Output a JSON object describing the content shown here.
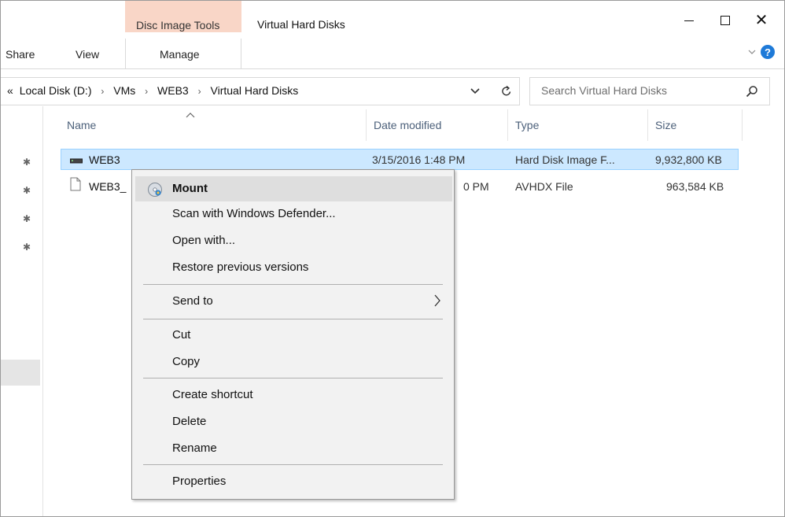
{
  "titlebar": {
    "contextual_tab": "Disc Image Tools",
    "title": "Virtual Hard Disks",
    "close_glyph": "✕"
  },
  "ribbon": {
    "tabs": [
      "Share",
      "View",
      "Manage"
    ],
    "help_glyph": "?"
  },
  "address": {
    "overflow_glyph": "«",
    "crumbs": [
      "Local Disk (D:)",
      "VMs",
      "WEB3",
      "Virtual Hard Disks"
    ],
    "separator": "›"
  },
  "search": {
    "placeholder": "Search Virtual Hard Disks"
  },
  "columns": [
    "Name",
    "Date modified",
    "Type",
    "Size"
  ],
  "files": [
    {
      "name": "WEB3",
      "date": "3/15/2016 1:48 PM",
      "type": "Hard Disk Image F...",
      "size": "9,932,800 KB",
      "selected": true,
      "icon": "disk-image-icon"
    },
    {
      "name": "WEB3_",
      "date": "0 PM",
      "type": "AVHDX File",
      "size": "963,584 KB",
      "selected": false,
      "icon": "file-icon"
    }
  ],
  "context_menu": {
    "items": [
      "Mount",
      "Scan with Windows Defender...",
      "Open with...",
      "Restore previous versions",
      "Send to",
      "Cut",
      "Copy",
      "Create shortcut",
      "Delete",
      "Rename",
      "Properties"
    ],
    "submenu_glyph": ">"
  },
  "colors": {
    "accent_tab": "#f9d6c7",
    "selection": "#cce8ff",
    "help": "#1e7ad8"
  }
}
